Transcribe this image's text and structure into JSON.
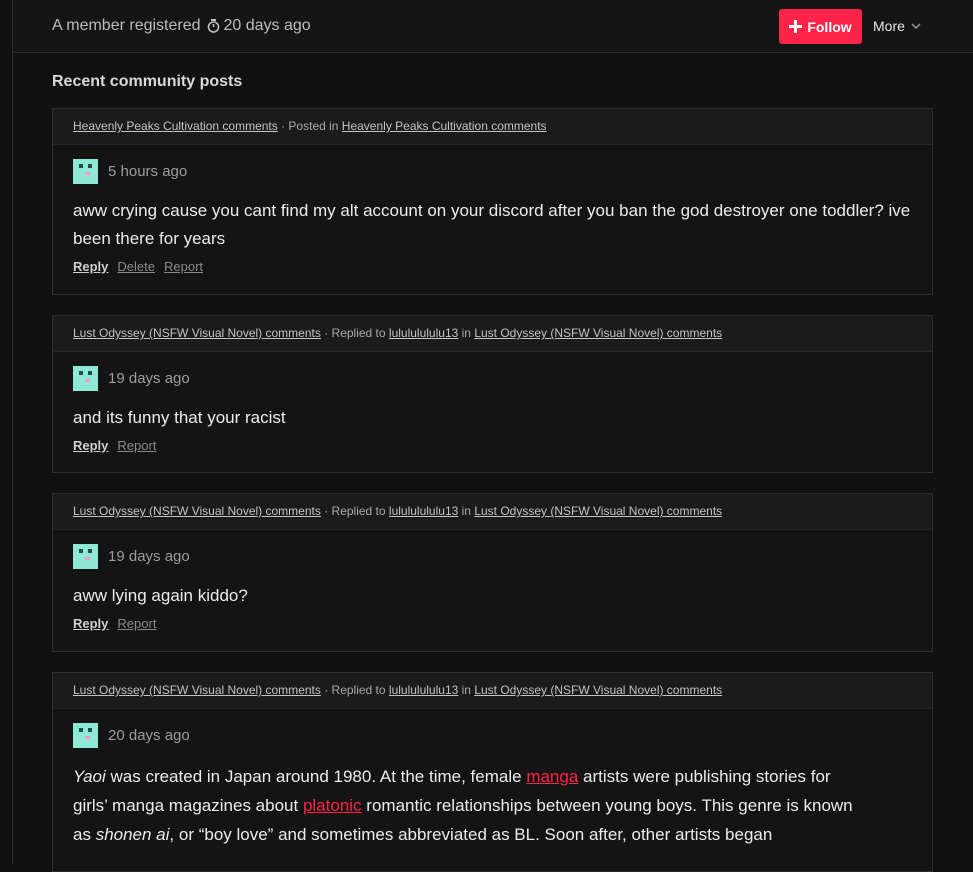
{
  "header": {
    "registered_text": "A member registered",
    "registered_time": "20 days ago",
    "follow_label": "Follow",
    "more_label": "More"
  },
  "section_title": "Recent community posts",
  "posts": [
    {
      "head_link1": "Heavenly Peaks Cultivation comments",
      "head_sep": " · Posted in ",
      "head_link2": "Heavenly Peaks Cultivation comments",
      "time": "5 hours ago",
      "body": "aww crying cause you cant find my alt account on your discord after you ban the god destroyer one toddler? ive been there for years",
      "actions": [
        "Reply",
        "Delete",
        "Report"
      ]
    },
    {
      "head_link1": "Lust Odyssey (NSFW Visual Novel) comments",
      "head_sep": " · Replied to ",
      "head_user": "lulululululu13",
      "head_in": " in ",
      "head_link2": "Lust Odyssey (NSFW Visual Novel) comments",
      "time": "19 days ago",
      "body": "and its funny that your racist",
      "actions": [
        "Reply",
        "Report"
      ]
    },
    {
      "head_link1": "Lust Odyssey (NSFW Visual Novel) comments",
      "head_sep": " · Replied to ",
      "head_user": "lulululululu13",
      "head_in": " in ",
      "head_link2": "Lust Odyssey (NSFW Visual Novel) comments",
      "time": "19 days ago",
      "body": "aww lying again kiddo?",
      "actions": [
        "Reply",
        "Report"
      ]
    },
    {
      "head_link1": "Lust Odyssey (NSFW Visual Novel) comments",
      "head_sep": " · Replied to ",
      "head_user": "lulululululu13",
      "head_in": " in ",
      "head_link2": "Lust Odyssey (NSFW Visual Novel) comments",
      "time": "20 days ago",
      "body_parts": {
        "p1_em": "Yaoi",
        "p1_a": " was created in Japan around 1980. At the time, female ",
        "p1_link": "manga",
        "p1_b": " artists were publishing stories for girls’ manga magazines about ",
        "p1_link2": "platonic",
        "p1_c": " romantic relationships between young boys. This genre is known as ",
        "p1_em2": "shonen ai",
        "p1_d": ", or “boy love” and sometimes abbreviated as BL. Soon after, other artists began"
      }
    }
  ],
  "colors": {
    "accent": "#ff2449",
    "background": "#111111",
    "card": "#141414",
    "card_header": "#1b1b1b"
  }
}
